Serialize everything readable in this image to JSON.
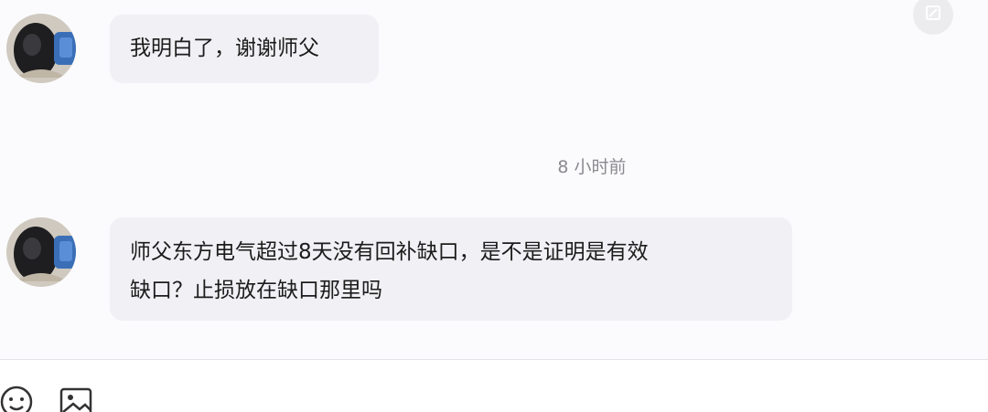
{
  "header": {
    "action_icon": "edit-icon"
  },
  "messages": [
    {
      "avatar_icon": "user-avatar",
      "text": "我明白了，谢谢师父"
    },
    {
      "avatar_icon": "user-avatar",
      "text_line1": "师父东方电气超过8天没有回补缺口，是不是证明是有效",
      "text_line2": "缺口？止损放在缺口那里吗"
    }
  ],
  "timestamp": "8 小时前",
  "toolbar": {
    "emoji_icon": "emoji-icon",
    "image_icon": "image-icon"
  },
  "colors": {
    "background": "#fbfbfd",
    "bubble": "#f1f1f5",
    "text": "#1c1c1c",
    "timestamp": "#8a8a8f"
  }
}
